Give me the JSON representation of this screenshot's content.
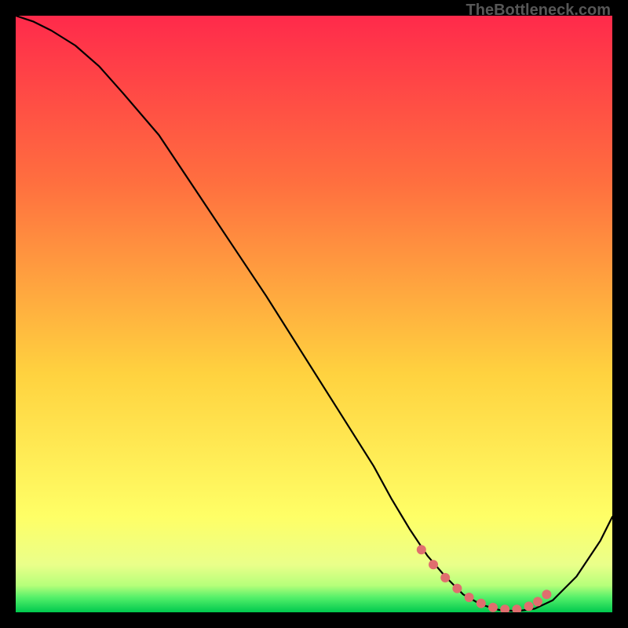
{
  "watermark": "TheBottleneck.com",
  "colors": {
    "bg": "#000000",
    "grad_top": "#ff2a4b",
    "grad_mid1": "#ff6f3f",
    "grad_mid2": "#ffd23f",
    "grad_low": "#ffff66",
    "grad_green_light": "#c8ff7a",
    "grad_green": "#00e060",
    "curve": "#000000",
    "marker": "#e06e6e"
  },
  "chart_data": {
    "type": "line",
    "title": "",
    "xlabel": "",
    "ylabel": "",
    "xlim": [
      0,
      100
    ],
    "ylim": [
      0,
      100
    ],
    "series": [
      {
        "name": "bottleneck-curve",
        "x": [
          0,
          3,
          6,
          10,
          14,
          18,
          24,
          30,
          36,
          42,
          48,
          54,
          60,
          63,
          66,
          69,
          72,
          75,
          78,
          81,
          84,
          87,
          90,
          94,
          98,
          100
        ],
        "y": [
          100,
          99,
          97.5,
          95,
          91.5,
          87,
          80,
          71,
          62,
          53,
          43.5,
          34,
          24.5,
          19,
          14,
          9.5,
          6,
          3,
          1.3,
          0.4,
          0.2,
          0.6,
          2,
          6,
          12,
          16
        ]
      }
    ],
    "markers": {
      "name": "sweet-spot",
      "x": [
        68,
        70,
        72,
        74,
        76,
        78,
        80,
        82,
        84,
        86,
        87.5,
        89
      ],
      "y": [
        10.5,
        8,
        5.8,
        4,
        2.5,
        1.5,
        0.8,
        0.5,
        0.5,
        1,
        1.8,
        3
      ]
    }
  }
}
